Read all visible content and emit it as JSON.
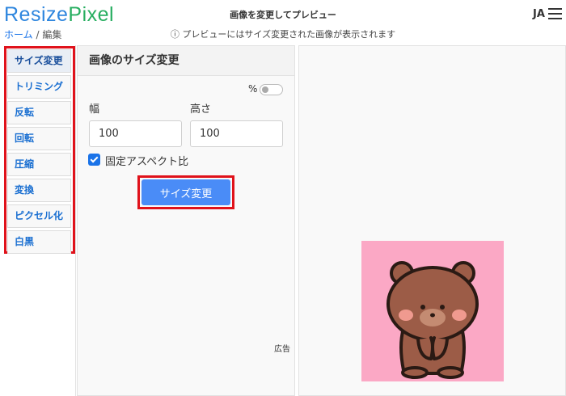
{
  "header": {
    "logo_part1": "Resize",
    "logo_part2": "Pixel",
    "page_title": "画像を変更してプレビュー",
    "info_icon": "ⓘ",
    "info_text": "プレビューにはサイズ変更された画像が表示されます",
    "language": "JA",
    "menu_icon": "hamburger-menu-icon"
  },
  "breadcrumb": {
    "home": "ホーム",
    "separator": "/",
    "current": "編集"
  },
  "sidebar": {
    "items": [
      {
        "label": "サイズ変更",
        "active": true
      },
      {
        "label": "トリミング",
        "active": false
      },
      {
        "label": "反転",
        "active": false
      },
      {
        "label": "回転",
        "active": false
      },
      {
        "label": "圧縮",
        "active": false
      },
      {
        "label": "変換",
        "active": false
      },
      {
        "label": "ピクセル化",
        "active": false
      },
      {
        "label": "白黒",
        "active": false
      }
    ]
  },
  "resize_panel": {
    "title": "画像のサイズ変更",
    "percent_label": "%",
    "percent_toggle_on": false,
    "width_label": "幅",
    "width_value": "100",
    "height_label": "高さ",
    "height_value": "100",
    "aspect_label": "固定アスペクト比",
    "aspect_checked": true,
    "submit_label": "サイズ変更",
    "ad_label": "広告"
  },
  "preview": {
    "background_color": "#fba8c5",
    "subject": "brown bear illustration"
  },
  "colors": {
    "accent": "#4a8cf7",
    "highlight_frame": "#e0121b",
    "logo_blue": "#2e86de",
    "logo_green": "#27ae60"
  }
}
